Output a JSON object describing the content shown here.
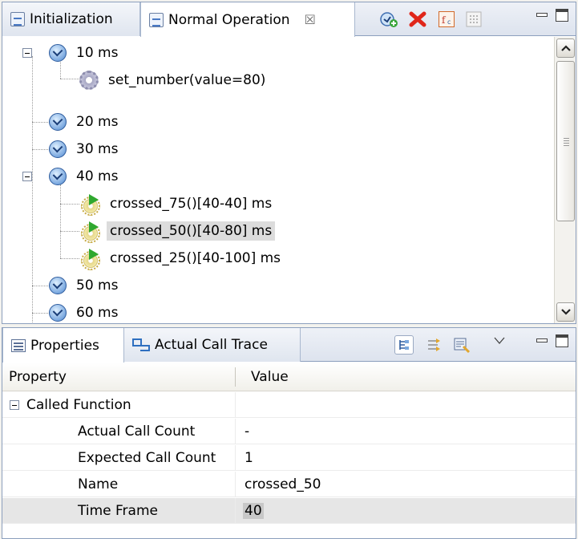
{
  "top_view": {
    "tabs": [
      {
        "label": "Initialization",
        "active": false
      },
      {
        "label": "Normal Operation",
        "active": true
      }
    ],
    "close_glyph": "☒",
    "toolbar_icons": [
      "add-timeframe-icon",
      "delete-icon",
      "function-icon",
      "grid-icon"
    ],
    "tree": [
      {
        "label": "10 ms",
        "icon": "clock-icon",
        "expanded": true
      },
      {
        "label": "set_number(value=80)",
        "icon": "gear-icon"
      },
      {
        "label": "20 ms",
        "icon": "clock-icon"
      },
      {
        "label": "30 ms",
        "icon": "clock-icon"
      },
      {
        "label": "40 ms",
        "icon": "clock-icon",
        "expanded": true
      },
      {
        "label": "crossed_75()[40-40] ms",
        "icon": "gear-green-icon"
      },
      {
        "label": "crossed_50()[40-80] ms",
        "icon": "gear-green-icon",
        "selected": true
      },
      {
        "label": "crossed_25()[40-100] ms",
        "icon": "gear-green-icon"
      },
      {
        "label": "50 ms",
        "icon": "clock-icon"
      },
      {
        "label": "60 ms",
        "icon": "clock-icon"
      }
    ]
  },
  "bottom_view": {
    "tabs": [
      {
        "label": "Properties",
        "active": true
      },
      {
        "label": "Actual Call Trace",
        "active": false
      }
    ],
    "columns": {
      "property": "Property",
      "value": "Value"
    },
    "rows": [
      {
        "property": "Called Function",
        "value": ""
      },
      {
        "property": "Actual Call Count",
        "value": "-"
      },
      {
        "property": "Expected Call Count",
        "value": "1"
      },
      {
        "property": "Name",
        "value": "crossed_50"
      },
      {
        "property": "Time Frame",
        "value": "40",
        "selected": true
      }
    ]
  },
  "colors": {
    "frame_border": "#8c9fbd",
    "selection_gray": "#dcdcdc",
    "green_arrow": "#2fa82f",
    "delete_red": "#e0261a"
  }
}
